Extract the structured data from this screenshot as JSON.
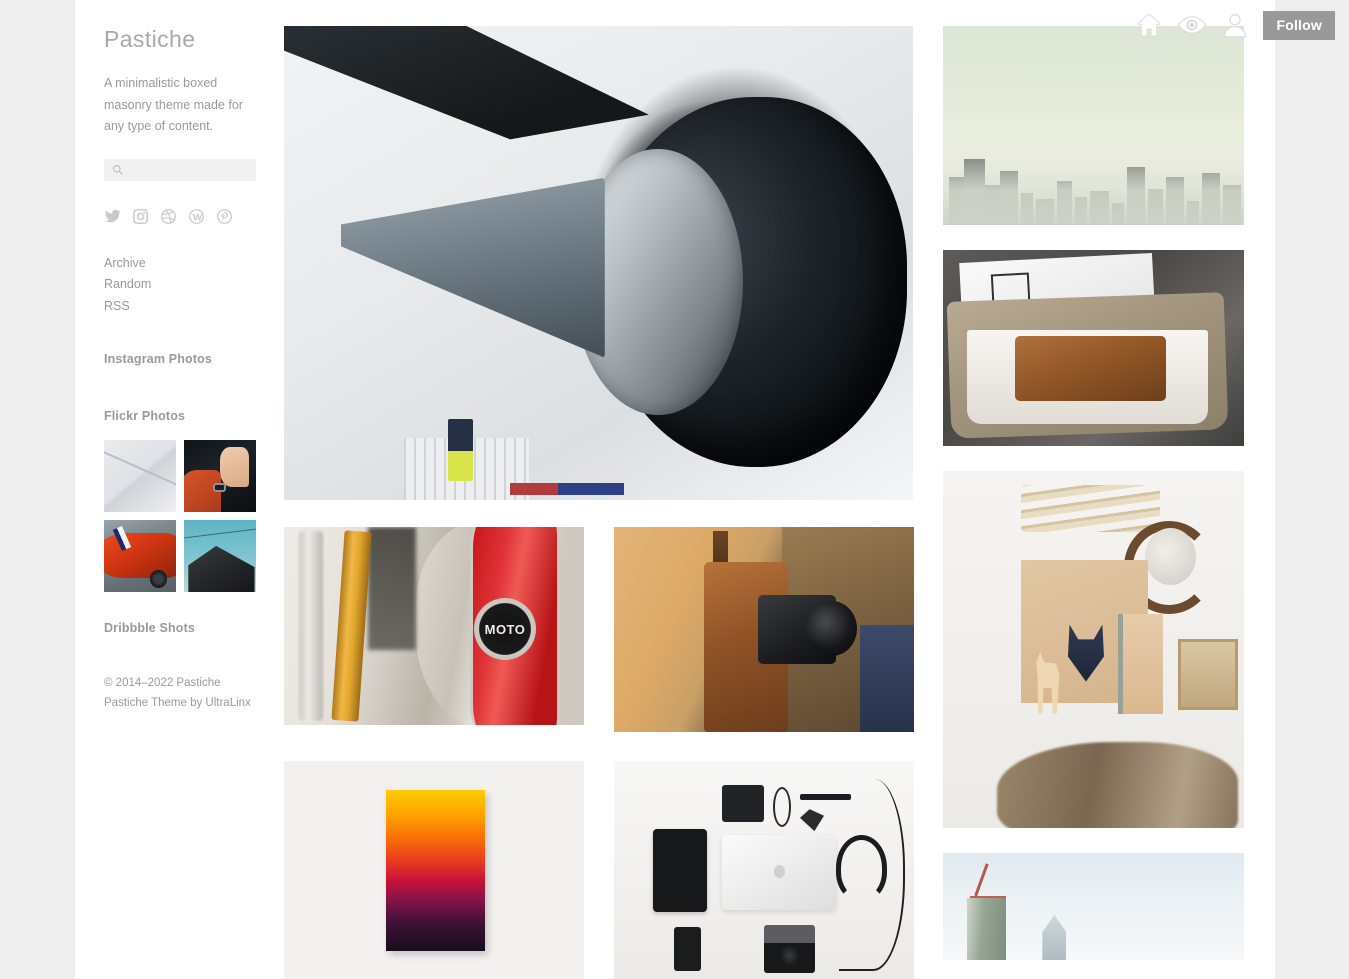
{
  "site": {
    "title": "Pastiche",
    "description": "A minimalistic boxed masonry theme made for any type of content."
  },
  "search": {
    "value": "",
    "placeholder": "",
    "icon": "search-icon"
  },
  "social_links": [
    {
      "name": "twitter",
      "label": "Twitter"
    },
    {
      "name": "instagram",
      "label": "Instagram"
    },
    {
      "name": "dribbble",
      "label": "Dribbble"
    },
    {
      "name": "wordpress",
      "label": "WordPress"
    },
    {
      "name": "pinterest",
      "label": "Pinterest"
    }
  ],
  "nav_links": [
    {
      "label": "Archive"
    },
    {
      "label": "Random"
    },
    {
      "label": "RSS"
    }
  ],
  "widgets": {
    "instagram_title": "Instagram Photos",
    "flickr_title": "Flickr Photos",
    "dribbble_title": "Dribbble Shots"
  },
  "flickr_photos": [
    {
      "alt": "White paper sheet on light surface"
    },
    {
      "alt": "Hand with watch on dark car dashboard"
    },
    {
      "alt": "Orange sports car with racing stripe"
    },
    {
      "alt": "Dark angular house against teal sky"
    }
  ],
  "footer": {
    "copyright": "© 2014–2022 Pastiche",
    "credit": "Pastiche Theme by UltraLinx"
  },
  "topbar": {
    "icons": [
      {
        "name": "home-icon",
        "label": "Home"
      },
      {
        "name": "eye-icon",
        "label": "Preview"
      },
      {
        "name": "account-icon",
        "label": "Account"
      }
    ],
    "follow_label": "Follow"
  },
  "posts": {
    "center_feature": {
      "alt": "Close-up of jet aircraft engine nacelle and nose cone"
    },
    "center_grid": [
      {
        "alt": "Vintage motorcycle fuel tank with MOTO emblem",
        "badge_text": "MOTO"
      },
      {
        "alt": "Person carrying leather camera bag and DSLR camera"
      },
      {
        "alt": "Sunset gradient canvas artwork on white wall"
      },
      {
        "alt": "Flat lay of laptop, tablet, phone, camera and headphones"
      }
    ],
    "right_column": [
      {
        "alt": "City skyline silhouette under pale green sky"
      },
      {
        "alt": "Brown leather wallet inside beige leather pouch"
      },
      {
        "alt": "Kraft paper branding flat lay with headphones and fur rug"
      },
      {
        "alt": "Tower under construction with crane against blue sky"
      }
    ]
  },
  "colors": {
    "page_background": "#eeeeee",
    "sheet_background": "#ffffff",
    "text_muted": "#9a9a9a",
    "title": "#a9a9a9",
    "search_field": "#f1f1f1",
    "follow_button": "#999999",
    "follow_text": "#ffffff"
  }
}
